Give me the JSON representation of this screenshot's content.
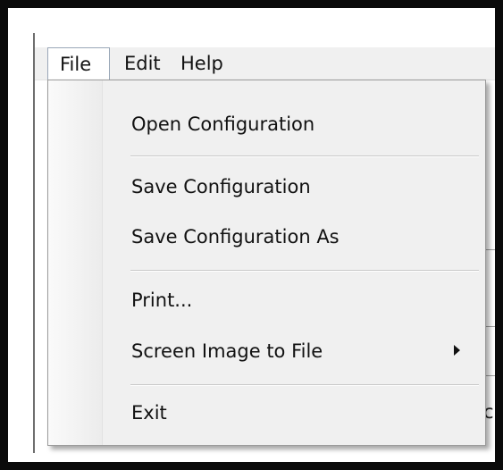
{
  "menubar": {
    "items": [
      {
        "label": "File"
      },
      {
        "label": "Edit"
      },
      {
        "label": "Help"
      }
    ],
    "active": "File"
  },
  "file_menu": {
    "items": [
      {
        "label": "Open Configuration"
      },
      {
        "label": "Save Configuration"
      },
      {
        "label": "Save Configuration As"
      },
      {
        "label": "Print..."
      },
      {
        "label": "Screen Image to File",
        "has_submenu": true
      },
      {
        "label": "Exit"
      }
    ]
  },
  "background": {
    "fragment_text": "c"
  },
  "colors": {
    "frame": "#0a0a0a",
    "menu_background": "#f0f0f0",
    "active_menu_border": "#9aa7b8",
    "separator": "#c8c8c8",
    "text": "#111111"
  },
  "icons": {
    "submenu_arrow": "triangle-right-icon"
  }
}
